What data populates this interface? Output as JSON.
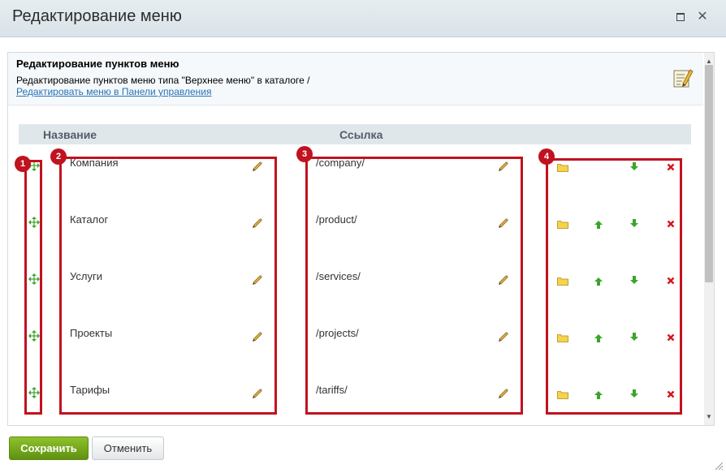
{
  "dialog": {
    "title": "Редактирование меню",
    "maximize_icon": "maximize-icon",
    "close_icon": "close-icon",
    "close_glyph": "✕"
  },
  "info": {
    "title": "Редактирование пунктов меню",
    "description": "Редактирование пунктов меню типа \"Верхнее меню\" в каталоге /",
    "link": "Редактировать меню в Панели управления",
    "icon": "edit-menu-icon"
  },
  "table": {
    "headers": {
      "name": "Название",
      "link": "Ссылка"
    },
    "rows": [
      {
        "name": "Компания",
        "url": "/company/",
        "can_move_up": false
      },
      {
        "name": "Каталог",
        "url": "/product/",
        "can_move_up": true
      },
      {
        "name": "Услуги",
        "url": "/services/",
        "can_move_up": true
      },
      {
        "name": "Проекты",
        "url": "/projects/",
        "can_move_up": true
      },
      {
        "name": "Тарифы",
        "url": "/tariffs/",
        "can_move_up": true
      }
    ],
    "row_icons": [
      "drag-move-icon",
      "pencil-edit-icon",
      "folder-icon",
      "arrow-up-icon",
      "arrow-down-icon",
      "delete-icon"
    ]
  },
  "annotations": [
    "1",
    "2",
    "3",
    "4"
  ],
  "buttons": {
    "save": "Сохранить",
    "cancel": "Отменить"
  },
  "colors": {
    "highlight": "#c1121f",
    "save_button": "#6fa31a",
    "link": "#2a72b5",
    "arrow_green": "#3aa52a",
    "delete_red": "#d8141f",
    "folder_yellow": "#f5d44a"
  }
}
